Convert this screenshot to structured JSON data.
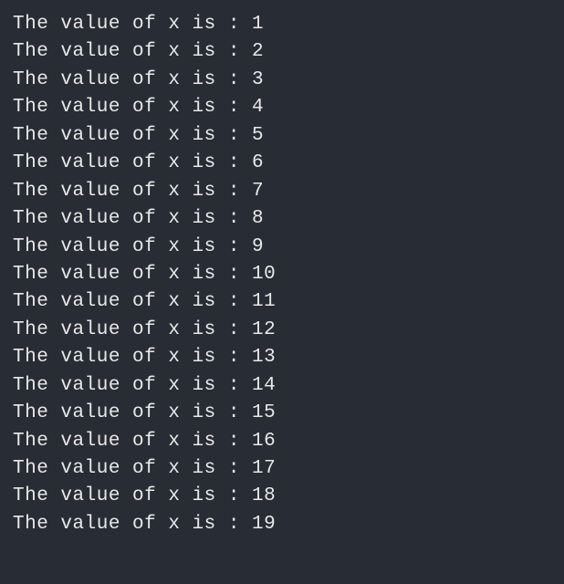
{
  "terminal": {
    "prefix": "The value of x is : ",
    "values": [
      1,
      2,
      3,
      4,
      5,
      6,
      7,
      8,
      9,
      10,
      11,
      12,
      13,
      14,
      15,
      16,
      17,
      18,
      19
    ]
  }
}
